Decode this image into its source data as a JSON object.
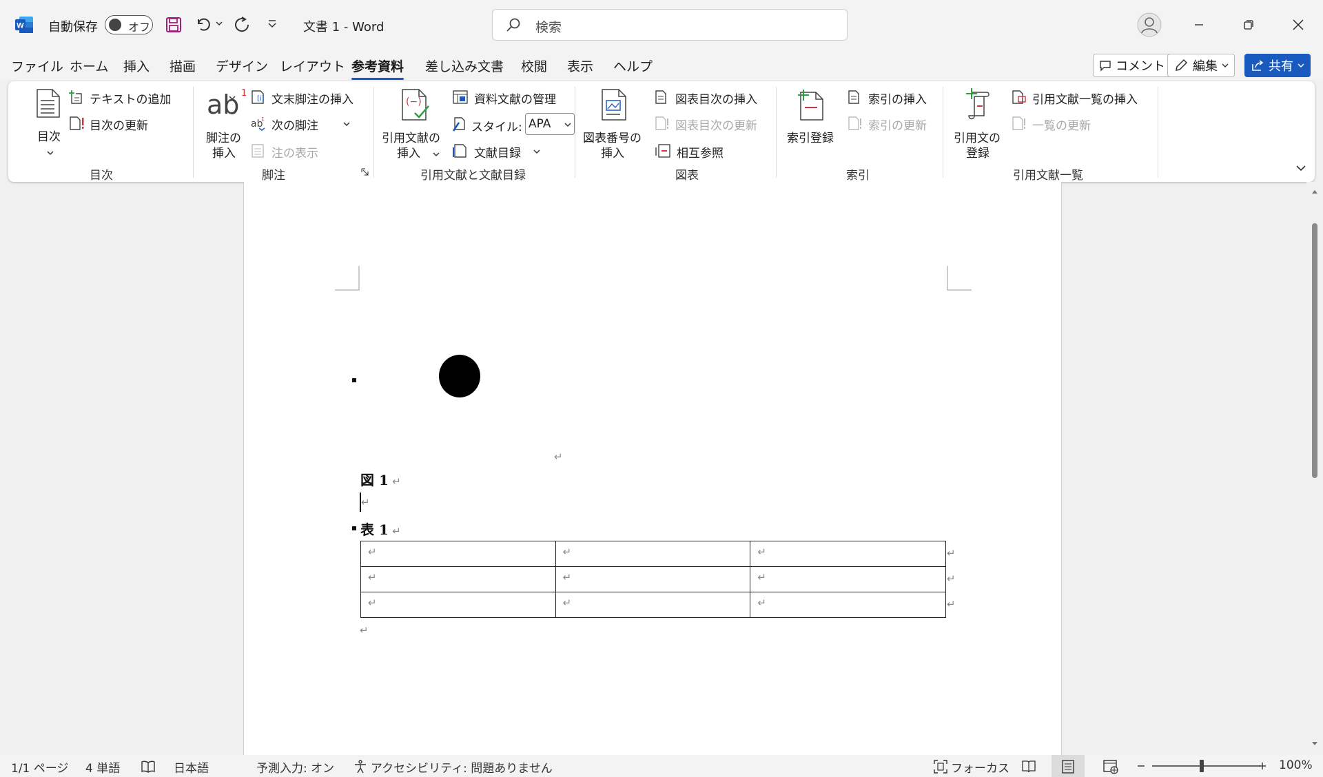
{
  "titlebar": {
    "autosave_label": "自動保存",
    "autosave_state": "オフ",
    "doc_title": "文書 1  -  Word",
    "search_placeholder": "検索"
  },
  "tabs": [
    "ファイル",
    "ホーム",
    "挿入",
    "描画",
    "デザイン",
    "レイアウト",
    "参考資料",
    "差し込み文書",
    "校閲",
    "表示",
    "ヘルプ"
  ],
  "active_tab": "参考資料",
  "actions": {
    "comment": "コメント",
    "edit": "編集",
    "share": "共有"
  },
  "ribbon": {
    "toc": {
      "big": "目次",
      "add_text": "テキストの追加",
      "update": "目次の更新",
      "group": "目次"
    },
    "footnotes": {
      "big1": "脚注の",
      "big2": "挿入",
      "ab": "ab",
      "endnote": "文末脚注の挿入",
      "next": "次の脚注",
      "show": "注の表示",
      "group": "脚注"
    },
    "citations": {
      "big1": "引用文献の",
      "big2": "挿入",
      "manage": "資料文献の管理",
      "style_label": "スタイル:",
      "style_value": "APA",
      "bibliography": "文献目録",
      "group": "引用文献と文献目録"
    },
    "captions": {
      "big1": "図表番号の",
      "big2": "挿入",
      "insert_tof": "図表目次の挿入",
      "update_tof": "図表目次の更新",
      "cross_ref": "相互参照",
      "group": "図表"
    },
    "index": {
      "big": "索引登録",
      "insert": "索引の挿入",
      "update": "索引の更新",
      "group": "索引"
    },
    "toa": {
      "big1": "引用文の",
      "big2": "登録",
      "insert": "引用文献一覧の挿入",
      "update": "一覧の更新",
      "group": "引用文献一覧"
    }
  },
  "document": {
    "figure_caption": "図 1",
    "table_caption": "表 1",
    "para_mark": "↵",
    "table_rows": 3,
    "table_cols": 3
  },
  "statusbar": {
    "page": "1/1 ページ",
    "words": "4 単語",
    "language": "日本語",
    "predictive": "予測入力: オン",
    "accessibility": "アクセシビリティ: 問題ありません",
    "focus": "フォーカス",
    "zoom": "100%"
  },
  "colors": {
    "word_blue": "#185abd",
    "save_purple": "#a0207a",
    "green_add": "#2e9e3e",
    "red_mark": "#d13438"
  }
}
